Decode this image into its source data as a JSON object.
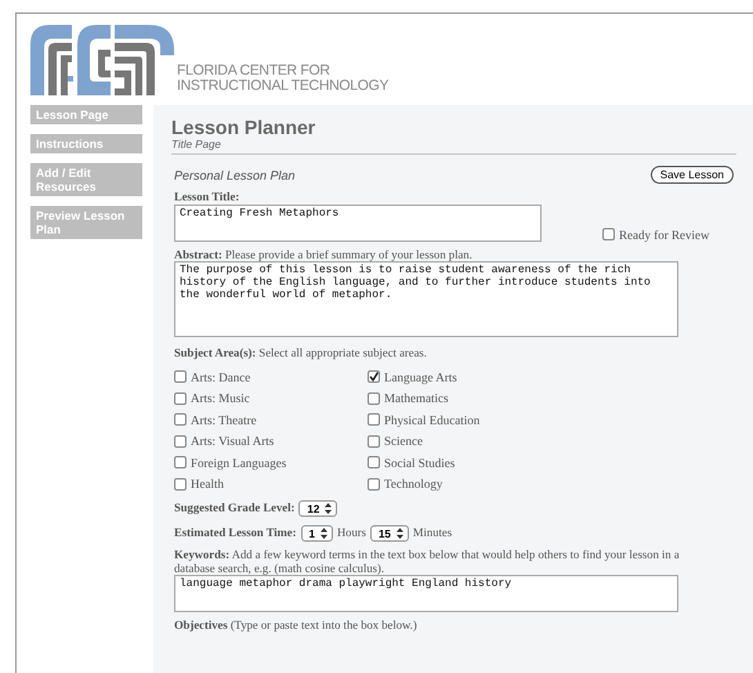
{
  "header": {
    "org_line_1": "FLORIDA CENTER FOR",
    "org_line_2": "INSTRUCTIONAL TECHNOLOGY"
  },
  "sidebar": {
    "items": [
      {
        "label": "Lesson Page"
      },
      {
        "label": "Instructions"
      },
      {
        "label": "Add / Edit Resources"
      },
      {
        "label": "Preview Lesson Plan"
      }
    ]
  },
  "page": {
    "title": "Lesson Planner",
    "subtitle": "Title Page",
    "plan_type": "Personal Lesson Plan",
    "save_button": "Save Lesson"
  },
  "lesson_title": {
    "label": "Lesson Title:",
    "value": "Creating Fresh Metaphors"
  },
  "ready_for_review": {
    "label": "Ready for Review",
    "checked": false
  },
  "abstract": {
    "label": "**Abstract:** Please provide a brief summary of your lesson plan.",
    "value": "The purpose of this lesson is to raise student awareness of the rich history of the English language, and to further introduce students into the wonderful world of metaphor."
  },
  "subject_areas": {
    "label": "**Subject Area(s):** Select all appropriate subject areas.",
    "options": [
      {
        "label": "Arts: Dance",
        "checked": false
      },
      {
        "label": "Language Arts",
        "checked": true
      },
      {
        "label": "Arts: Music",
        "checked": false
      },
      {
        "label": "Mathematics",
        "checked": false
      },
      {
        "label": "Arts: Theatre",
        "checked": false
      },
      {
        "label": "Physical Education",
        "checked": false
      },
      {
        "label": "Arts: Visual Arts",
        "checked": false
      },
      {
        "label": "Science",
        "checked": false
      },
      {
        "label": "Foreign Languages",
        "checked": false
      },
      {
        "label": "Social Studies",
        "checked": false
      },
      {
        "label": "Health",
        "checked": false
      },
      {
        "label": "Technology",
        "checked": false
      }
    ]
  },
  "grade_level": {
    "label": "Suggested Grade Level:",
    "value": "12"
  },
  "lesson_time": {
    "label": "Estimated Lesson Time:",
    "hours": "1",
    "hours_unit": "Hours",
    "minutes": "15",
    "minutes_unit": "Minutes"
  },
  "keywords": {
    "label": "**Keywords:** Add a few keyword terms in the text box below that would help others to find your lesson in a database search, e.g. (math cosine calculus).",
    "value": "language metaphor drama playwright England history"
  },
  "objectives": {
    "label": "**Objectives** (Type or paste text into the box below.)"
  }
}
